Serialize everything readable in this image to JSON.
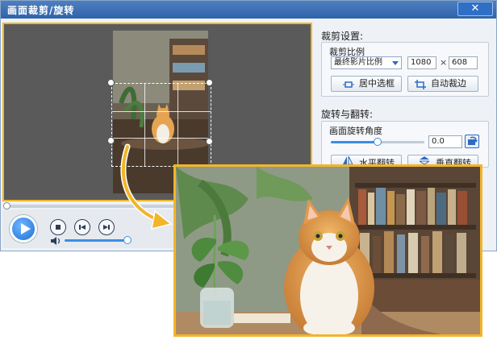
{
  "window": {
    "title": "画面裁剪/旋转",
    "close_glyph": "✕"
  },
  "crop_settings": {
    "section_title": "裁剪设置:",
    "ratio_label": "裁剪比例",
    "ratio_value": "最终影片比例",
    "width": "1080",
    "height": "608",
    "times_glyph": "×",
    "center_button": "居中选框",
    "auto_button": "自动裁边"
  },
  "rotate_flip": {
    "section_title": "旋转与翻转:",
    "angle_label": "画面旋转角度",
    "angle_value": "0.0",
    "angle_fraction": 0.5,
    "hflip_button": "水平翻转",
    "vflip_button": "垂直翻转"
  },
  "player": {
    "seek_fraction": 0.0,
    "volume_fraction": 0.95
  },
  "colors": {
    "accent_orange": "#f2b52a",
    "accent_blue": "#2e6bc0"
  }
}
